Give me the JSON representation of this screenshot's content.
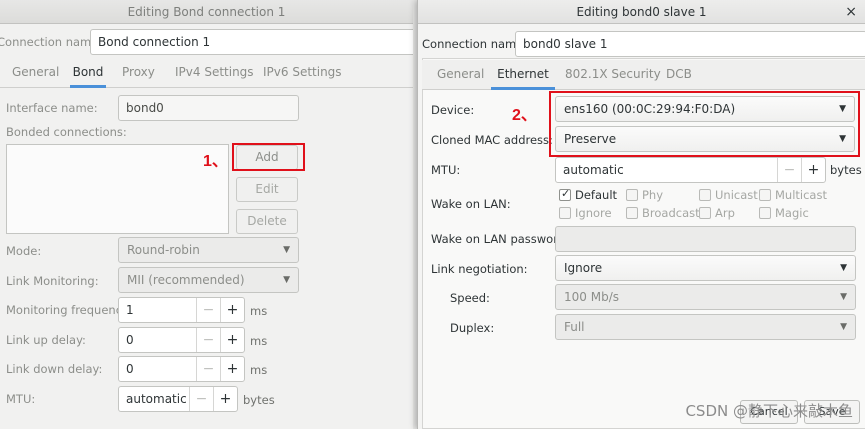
{
  "left": {
    "title": "Editing Bond connection 1",
    "connection_name_label": "Connection name:",
    "connection_name_value": "Bond connection 1",
    "tabs": [
      "General",
      "Bond",
      "Proxy",
      "IPv4 Settings",
      "IPv6 Settings"
    ],
    "active_tab": "Bond",
    "interface_name_label": "Interface name:",
    "interface_name_value": "bond0",
    "bonded_connections_label": "Bonded connections:",
    "buttons": {
      "add": "Add",
      "edit": "Edit",
      "delete": "Delete"
    },
    "mode_label": "Mode:",
    "mode_value": "Round-robin",
    "link_monitoring_label": "Link Monitoring:",
    "link_monitoring_value": "MII (recommended)",
    "monitoring_frequency_label": "Monitoring frequency:",
    "monitoring_frequency_value": "1",
    "link_up_delay_label": "Link up delay:",
    "link_up_delay_value": "0",
    "link_down_delay_label": "Link down delay:",
    "link_down_delay_value": "0",
    "mtu_label": "MTU:",
    "mtu_value": "automatic",
    "unit_ms": "ms",
    "unit_bytes": "bytes",
    "annotation": "1、"
  },
  "right": {
    "title": "Editing bond0 slave 1",
    "connection_name_label": "Connection name:",
    "connection_name_value": "bond0 slave 1",
    "tabs": [
      "General",
      "Ethernet",
      "802.1X Security",
      "DCB"
    ],
    "active_tab": "Ethernet",
    "device_label": "Device:",
    "device_value": "ens160 (00:0C:29:94:F0:DA)",
    "cloned_mac_label": "Cloned MAC address:",
    "cloned_mac_value": "Preserve",
    "mtu_label": "MTU:",
    "mtu_value": "automatic",
    "mtu_unit": "bytes",
    "wake_on_lan_label": "Wake on LAN:",
    "wake_on_lan_options": [
      {
        "label": "Default",
        "checked": true
      },
      {
        "label": "Phy",
        "checked": false
      },
      {
        "label": "Unicast",
        "checked": false
      },
      {
        "label": "Multicast",
        "checked": false
      },
      {
        "label": "Ignore",
        "checked": false
      },
      {
        "label": "Broadcast",
        "checked": false
      },
      {
        "label": "Arp",
        "checked": false
      },
      {
        "label": "Magic",
        "checked": false
      }
    ],
    "wake_on_lan_password_label": "Wake on LAN password:",
    "link_negotiation_label": "Link negotiation:",
    "link_negotiation_value": "Ignore",
    "speed_label": "Speed:",
    "speed_value": "100 Mb/s",
    "duplex_label": "Duplex:",
    "duplex_value": "Full",
    "annotation": "2、",
    "cancel_label": "Cancel",
    "save_label": "Save"
  },
  "watermark": "CSDN @静下心来敲木鱼",
  "colors": {
    "annotation_red": "#e0101a",
    "tab_underline": "#4a90d9"
  }
}
